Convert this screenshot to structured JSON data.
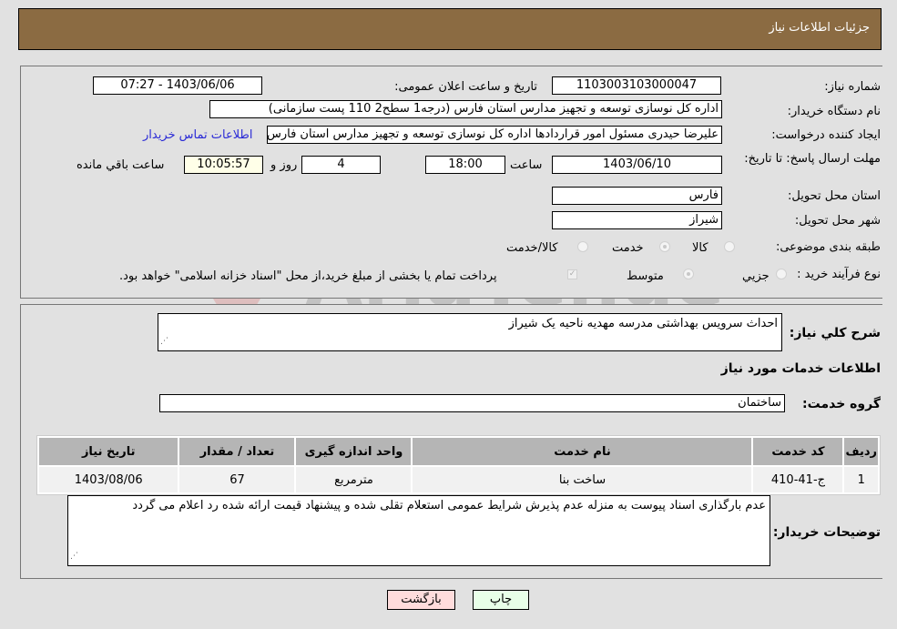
{
  "header": {
    "title": "جزئیات اطلاعات نیاز"
  },
  "form": {
    "need_number": {
      "label": "شماره نیاز:",
      "value": "1103003103000047"
    },
    "announce_datetime": {
      "label": "تاریخ و ساعت اعلان عمومی:",
      "value": "1403/06/06 - 07:27"
    },
    "buyer_org": {
      "label": "نام دستگاه خریدار:",
      "value": "اداره کل نوسازی   توسعه و تجهیز مدارس استان فارس (درجه1  سطح2  110 پست سازمانی)"
    },
    "requester": {
      "label": "ایجاد کننده درخواست:",
      "value": "علیرضا حیدری مسئول امور قراردادها اداره کل نوسازی   توسعه و تجهیز مدارس استان فارس"
    },
    "buyer_contact_link": "اطلاعات تماس خریدار",
    "deadline": {
      "label": "مهلت ارسال پاسخ: تا تاریخ:",
      "date": "1403/06/10",
      "time_label": "ساعت",
      "time": "18:00",
      "days": "4",
      "days_label": "روز و",
      "remaining": "10:05:57",
      "remaining_label": "ساعت باقي مانده"
    },
    "province": {
      "label": "استان محل تحویل:",
      "value": "فارس"
    },
    "city": {
      "label": "شهر محل تحویل:",
      "value": "شیراز"
    },
    "category": {
      "label": "طبقه بندی موضوعی:",
      "options": [
        {
          "label": "کالا",
          "checked": false
        },
        {
          "label": "خدمت",
          "checked": true
        },
        {
          "label": "کالا/خدمت",
          "checked": false
        }
      ]
    },
    "process_type": {
      "label": "نوع فرآیند خرید :",
      "options": [
        {
          "label": "جزيي",
          "checked": false
        },
        {
          "label": "متوسط",
          "checked": true
        }
      ],
      "treasury_note": "پرداخت تمام یا بخشی از مبلغ خرید،از محل \"اسناد خزانه اسلامی\" خواهد بود.",
      "treasury_checked": true
    }
  },
  "details": {
    "description": {
      "label": "شرح كلي نياز:",
      "value": "احداث سرویس بهداشتی مدرسه  مهدیه ناحیه یک شیراز"
    },
    "services_title": "اطلاعات خدمات مورد نیاز",
    "service_group": {
      "label": "گروه خدمت:",
      "value": "ساختمان"
    },
    "table": {
      "headers": [
        "ردیف",
        "کد خدمت",
        "نام خدمت",
        "واحد اندازه گیری",
        "تعداد / مقدار",
        "تاریخ نیاز"
      ],
      "rows": [
        [
          "1",
          "ج-41-410",
          "ساخت بنا",
          "مترمربع",
          "67",
          "1403/08/06"
        ]
      ]
    },
    "buyer_notes": {
      "label": "توضیحات خریدار:",
      "value": "عدم بارگذاری اسناد پیوست به منزله عدم پذیرش شرایط عمومی استعلام تقلی شده و پیشنهاد قیمت ارائه شده رد اعلام می گردد"
    }
  },
  "buttons": {
    "print": "چاپ",
    "back": "بازگشت"
  },
  "watermark": "AriaTender.neT"
}
